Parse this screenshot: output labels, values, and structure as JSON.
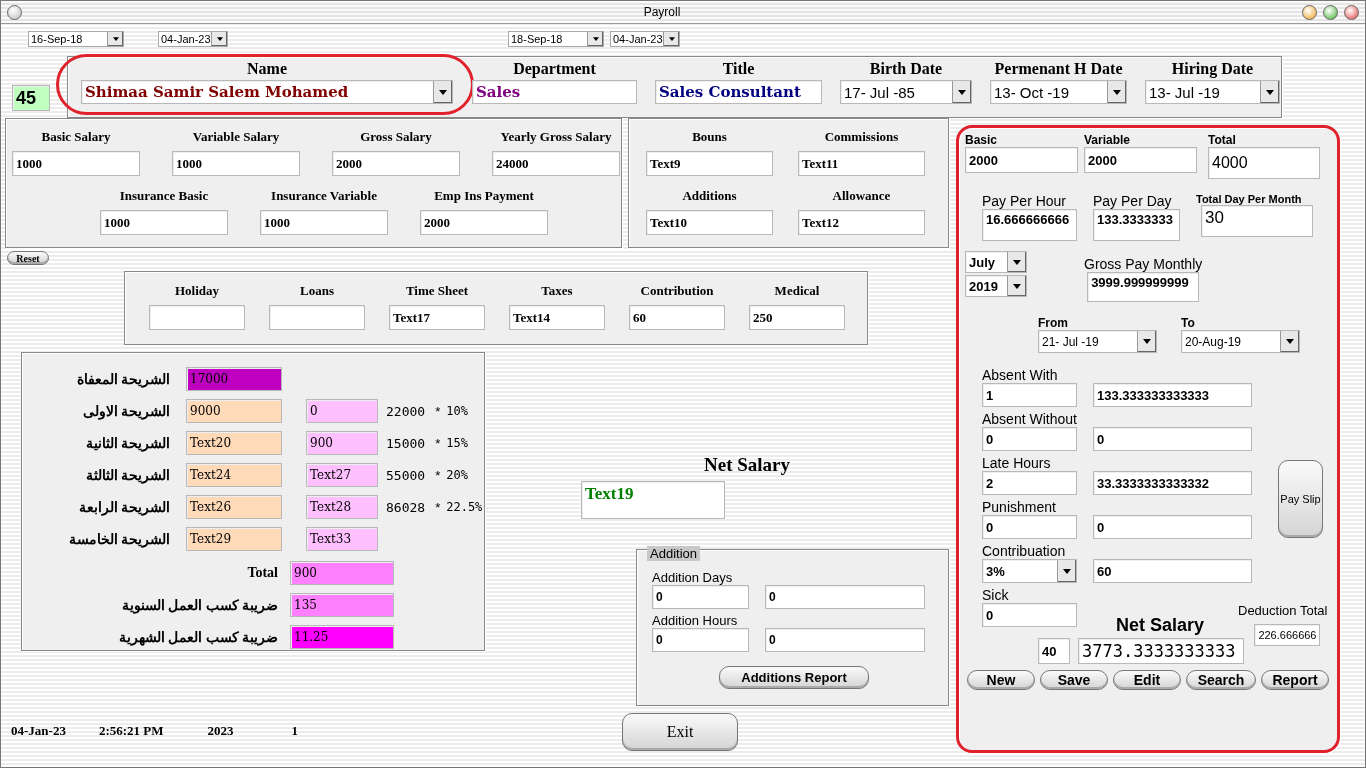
{
  "window": {
    "title": "Payroll"
  },
  "date_filters": [
    {
      "value": "16-Sep-18"
    },
    {
      "value": "04-Jan-23"
    },
    {
      "value": "18-Sep-18"
    },
    {
      "value": "04-Jan-23"
    }
  ],
  "employee": {
    "id": "45",
    "fields": [
      {
        "label": "Name",
        "value": "Shimaa Samir Salem Mohamed",
        "kind": "combo",
        "color": "#800000",
        "highlighted": true
      },
      {
        "label": "Department",
        "value": "Sales",
        "kind": "text",
        "color": "#800080",
        "highlighted": false
      },
      {
        "label": "Title",
        "value": "Sales Consultant",
        "kind": "text",
        "color": "#000080",
        "highlighted": false
      },
      {
        "label": "Birth Date",
        "value": "17- Jul -85",
        "kind": "combo",
        "color": "#000000",
        "highlighted": false
      },
      {
        "label": "Permenant H Date",
        "value": "13- Oct -19",
        "kind": "combo",
        "color": "#000000",
        "highlighted": false
      },
      {
        "label": "Hiring Date",
        "value": "13- Jul -19",
        "kind": "combo",
        "color": "#000000",
        "highlighted": false
      }
    ]
  },
  "salary": {
    "rows": [
      [
        {
          "label": "Basic Salary",
          "value": "1000"
        },
        {
          "label": "Variable Salary",
          "value": "1000"
        },
        {
          "label": "Gross Salary",
          "value": "2000"
        },
        {
          "label": "Yearly Gross Salary",
          "value": "24000"
        }
      ],
      [
        {
          "label": "Insurance Basic",
          "value": "1000"
        },
        {
          "label": "Insurance Variable",
          "value": "1000"
        },
        {
          "label": "Emp Ins Payment",
          "value": "2000"
        }
      ]
    ]
  },
  "extras": [
    {
      "label": "Bouns",
      "value": "Text9"
    },
    {
      "label": "Commissions",
      "value": "Text11"
    },
    {
      "label": "Additions",
      "value": "Text10"
    },
    {
      "label": "Allowance",
      "value": "Text12"
    }
  ],
  "reset_button": "Reset",
  "deductions": [
    {
      "label": "Holiday"
    },
    {
      "label": "Loans"
    },
    {
      "label": "Time Sheet",
      "value": "Text17"
    },
    {
      "label": "Taxes",
      "value": "Text14"
    },
    {
      "label": "Contribution",
      "value": "60"
    },
    {
      "label": "Medical",
      "value": "250"
    }
  ],
  "tax_brackets": [
    {
      "label": "الشريحة المعفاة",
      "base": {
        "value": "17000",
        "color": "#c000c0"
      }
    },
    {
      "label": "الشريحة الاولى",
      "base": {
        "value": "9000",
        "color": "#ffdab9"
      },
      "tax": "0",
      "amount": "22000",
      "operator": "*",
      "rate": "10%"
    },
    {
      "label": "الشريحة الثانية",
      "base": {
        "value": "Text20",
        "color": "#ffdab9"
      },
      "tax": "900",
      "amount": "15000",
      "operator": "*",
      "rate": "15%"
    },
    {
      "label": "الشريحة الثالثة",
      "base": {
        "value": "Text24",
        "color": "#ffdab9"
      },
      "tax": "Text27",
      "amount": "55000",
      "operator": "*",
      "rate": "20%"
    },
    {
      "label": "الشريحة الرابعة",
      "base": {
        "value": "Text26",
        "color": "#ffdab9"
      },
      "tax": "Text28",
      "amount": "86028",
      "operator": "*",
      "rate": "22.5%"
    },
    {
      "label": "الشريحة الخامسة",
      "base": {
        "value": "Text29",
        "color": "#ffdab9"
      },
      "tax": "Text33"
    }
  ],
  "tax_totals": [
    {
      "label": "Total",
      "value": "900",
      "color": "#ff80ff"
    },
    {
      "label": "ضريبة كسب العمل السنوية",
      "value": "135",
      "color": "#ff80ff"
    },
    {
      "label": "ضريبة كسب العمل الشهرية",
      "value": "11.25",
      "color": "#ff00ff"
    }
  ],
  "net_salary": {
    "label": "Net Salary",
    "value": "Text19"
  },
  "addition": {
    "title": "Addition",
    "rows": [
      {
        "label": "Addition Days",
        "days": "0",
        "amount": "0"
      },
      {
        "label": "Addition Hours",
        "days": "0",
        "amount": "0"
      }
    ],
    "report_button": "Additions Report"
  },
  "exit_button": "Exit",
  "status_bar": [
    "04-Jan-23",
    "2:56:21 PM",
    "2023",
    "1"
  ],
  "pay_panel": {
    "highlighted": true,
    "salary": [
      {
        "label": "Basic",
        "value": "2000"
      },
      {
        "label": "Variable",
        "value": "2000"
      },
      {
        "label": "Total",
        "value": "4000"
      }
    ],
    "rates": [
      {
        "label": "Pay Per Hour",
        "value": "16.666666666"
      },
      {
        "label": "Pay Per Day",
        "value": "133.3333333"
      },
      {
        "label": "Total Day Per Month",
        "value": "30"
      }
    ],
    "month": "July",
    "year": "2019",
    "gross": {
      "label": "Gross Pay Monthly",
      "value": "3999.999999999"
    },
    "period": [
      {
        "label": "From",
        "value": "21- Jul -19"
      },
      {
        "label": "To",
        "value": "20-Aug-19"
      }
    ],
    "deductions": [
      {
        "label": "Absent With",
        "kind": "pair",
        "count": "1",
        "amount": "133.333333333333"
      },
      {
        "label": "Absent Without",
        "kind": "pair",
        "count": "0",
        "amount": "0"
      },
      {
        "label": "Late Hours",
        "kind": "pair",
        "count": "2",
        "amount": "33.3333333333332"
      },
      {
        "label": "Punishment",
        "kind": "pair",
        "count": "0",
        "amount": "0"
      },
      {
        "label": "Contribuation",
        "kind": "combo",
        "count": "3%",
        "amount": "60"
      },
      {
        "label": "Sick",
        "kind": "single",
        "count": "0"
      }
    ],
    "pay_slip_button": "Pay Slip",
    "net": {
      "label": "Net Salary",
      "days": "40",
      "value": "3773.3333333333"
    },
    "deduction_total": {
      "label": "Deduction Total",
      "value": "226.666666"
    },
    "buttons": [
      "New",
      "Save",
      "Edit",
      "Search",
      "Report"
    ]
  }
}
